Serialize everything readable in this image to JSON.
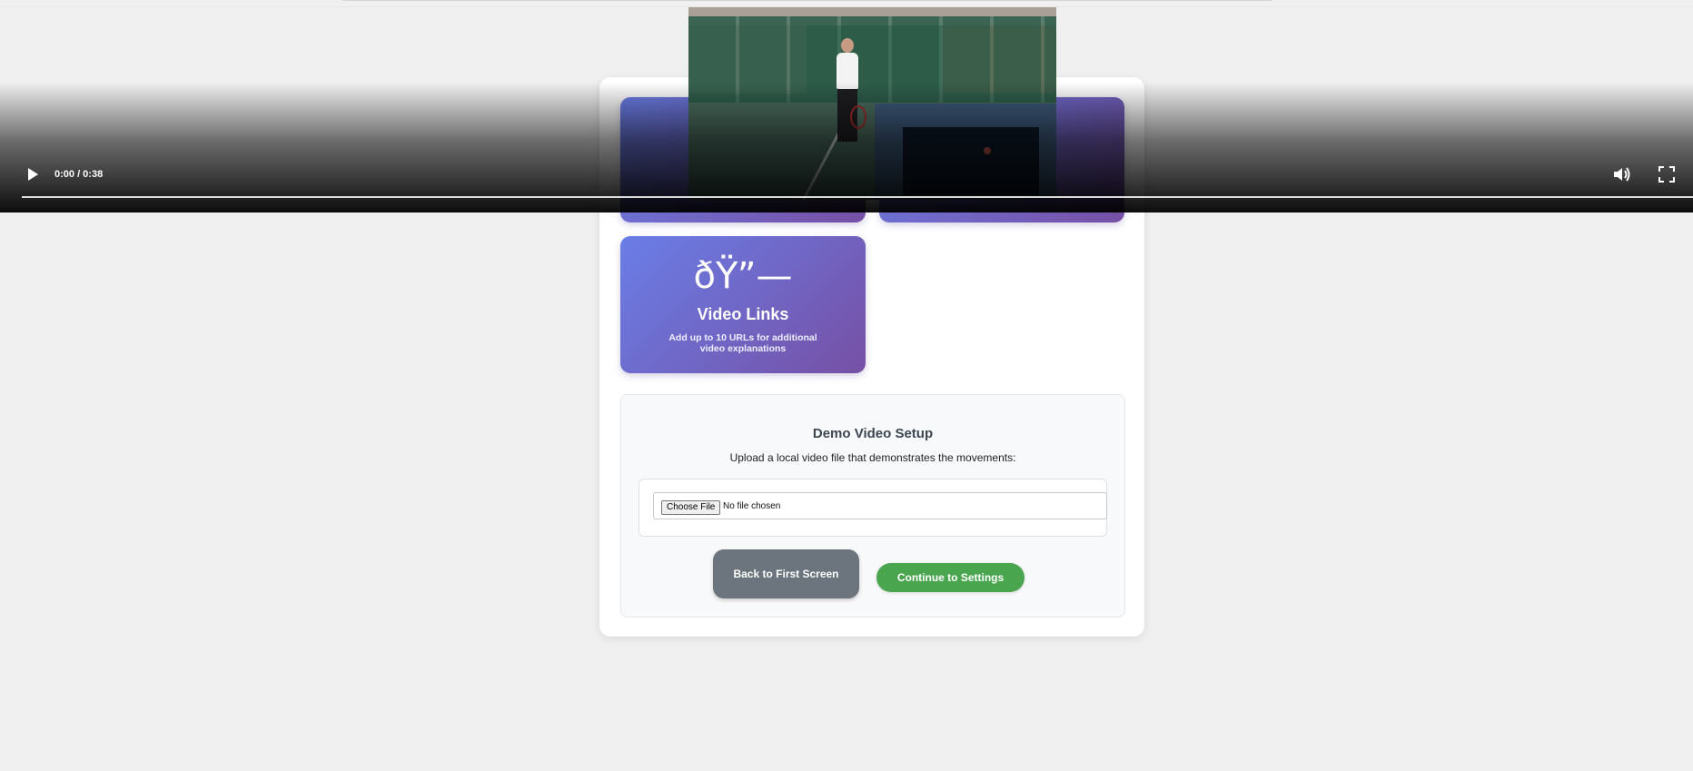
{
  "video_player": {
    "time_display": "0:00 / 0:38",
    "progress_fraction": 0.0,
    "controls": [
      "play-icon",
      "volume-icon",
      "fullscreen-icon"
    ]
  },
  "features": [
    {
      "icon_text": "",
      "title": "",
      "description": ""
    },
    {
      "icon_text": "",
      "title": "",
      "description": ""
    },
    {
      "icon_text": "ðŸ”—",
      "title": "Video Links",
      "description": "Add up to 10 URLs for additional video explanations"
    }
  ],
  "demo_setup": {
    "title": "Demo Video Setup",
    "description": "Upload a local video file that demonstrates the movements:",
    "file_input": {
      "button_label": "Choose File",
      "status": "No file chosen"
    },
    "back_button": "Back to First Screen",
    "continue_button": "Continue to Settings"
  },
  "colors": {
    "feature_gradient_start": "#6a7ee7",
    "feature_gradient_end": "#7650a5",
    "back_button": "#6c757d",
    "continue_button": "#4aa64e",
    "page_background": "#f0f0f0"
  }
}
